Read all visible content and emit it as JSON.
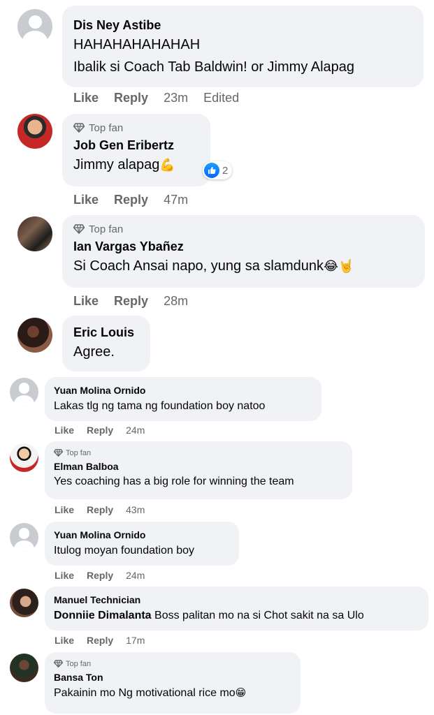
{
  "comments": [
    {
      "avatar": "default-avatar",
      "top_fan": false,
      "name": "Dis Ney Astibe",
      "lines": [
        "HAHAHAHAHAHAH",
        "Ibalik si Coach Tab Baldwin! or Jimmy Alapag"
      ],
      "like": "Like",
      "reply": "Reply",
      "time": "23m",
      "edited": "Edited"
    },
    {
      "avatar": "profile-photo",
      "top_fan": true,
      "badge": "Top fan",
      "name": "Job Gen Eribertz",
      "text": "Jimmy alapag",
      "emoji": "💪",
      "reaction_count": "2",
      "like": "Like",
      "reply": "Reply",
      "time": "47m"
    },
    {
      "avatar": "profile-photo",
      "top_fan": true,
      "badge": "Top fan",
      "name": "Ian Vargas Ybañez",
      "text": "Si Coach Ansai napo, yung sa slamdunk",
      "emoji": "😂🤘",
      "like": "Like",
      "reply": "Reply",
      "time": "28m"
    },
    {
      "avatar": "profile-photo",
      "top_fan": false,
      "name": "Eric Louis",
      "text": "Agree."
    },
    {
      "avatar": "default-avatar",
      "top_fan": false,
      "name": "Yuan Molina Ornido",
      "text": "Lakas tlg ng tama ng foundation boy natoo",
      "like": "Like",
      "reply": "Reply",
      "time": "24m"
    },
    {
      "avatar": "profile-photo",
      "top_fan": true,
      "badge": "Top fan",
      "name": "Elman Balboa",
      "text": "Yes coaching has a big role for winning the team",
      "like": "Like",
      "reply": "Reply",
      "time": "43m"
    },
    {
      "avatar": "default-avatar",
      "top_fan": false,
      "name": "Yuan Molina Ornido",
      "text": "Itulog moyan foundation boy",
      "like": "Like",
      "reply": "Reply",
      "time": "24m"
    },
    {
      "avatar": "profile-photo",
      "top_fan": false,
      "name": "Manuel Technician",
      "mention": "Donniie Dimalanta",
      "text": "Boss palitan mo na si Chot sakit na sa Ulo",
      "like": "Like",
      "reply": "Reply",
      "time": "17m"
    },
    {
      "avatar": "profile-photo",
      "top_fan": true,
      "badge": "Top fan",
      "name": "Bansa Ton",
      "text": "Pakainin mo Ng motivational rice mo",
      "emoji": "😁"
    }
  ]
}
